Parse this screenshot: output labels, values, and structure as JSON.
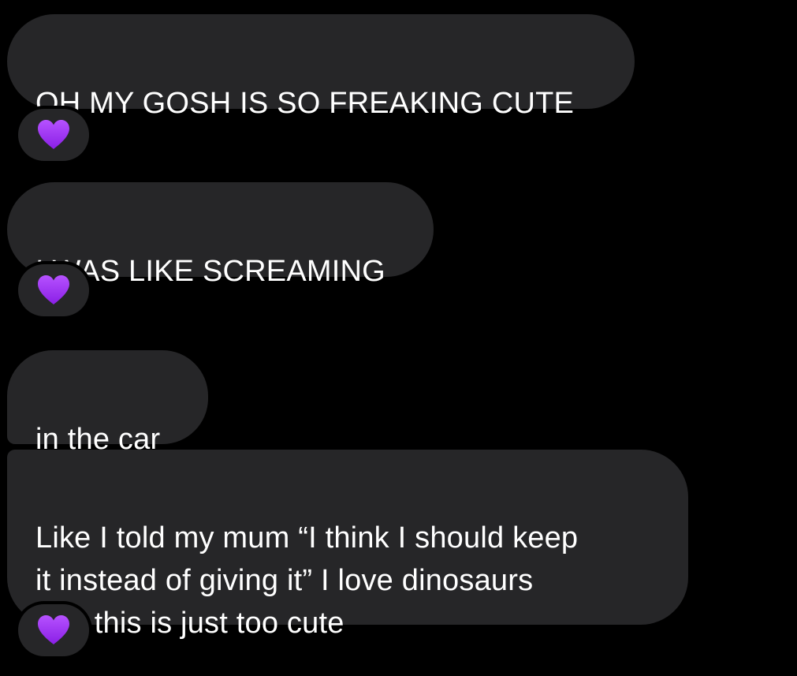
{
  "conversation": {
    "messages": [
      {
        "text": "OH MY GOSH IS SO FREAKING CUTE",
        "reaction": "purple-heart"
      },
      {
        "text": "I WAS LIKE SCREAMING",
        "reaction": "purple-heart"
      },
      {
        "text": "in the car"
      },
      {
        "text": "Like I told my mum “I think I should keep\nit instead of giving it” I love dinosaurs\nand this is just too cute",
        "reaction": "purple-heart"
      }
    ]
  },
  "colors": {
    "background": "#000000",
    "bubble": "#262628",
    "text": "#ffffff",
    "heart": "#a23cf5"
  }
}
